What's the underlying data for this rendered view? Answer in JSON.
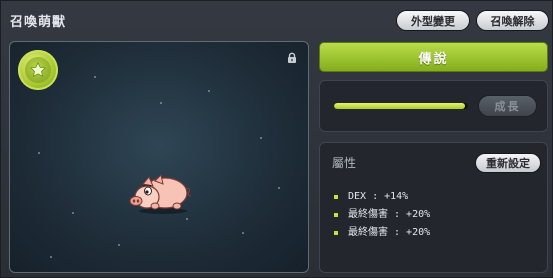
{
  "window": {
    "title": "召喚萌獸",
    "buttons": {
      "appearance": "外型變更",
      "release": "召喚解除"
    }
  },
  "pet_view": {
    "badge_icon": "star-icon",
    "lock_icon": "lock-icon",
    "pet_icon": "pig-pet"
  },
  "side": {
    "rank_button": "傳說",
    "growth": {
      "button": "成長",
      "progress_fraction": 0.98
    },
    "attributes": {
      "title": "屬性",
      "reset_button": "重新設定",
      "items": [
        "DEX : +14%",
        "最終傷害 : +20%",
        "最終傷害 : +20%"
      ]
    }
  },
  "colors": {
    "accent_green": "#9bc431",
    "bullet": "#c8e23f"
  }
}
